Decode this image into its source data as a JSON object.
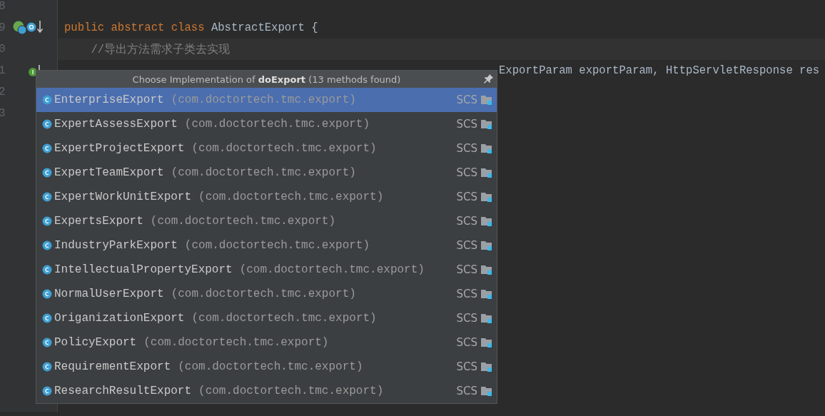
{
  "editor": {
    "lines": [
      {
        "number": "8"
      },
      {
        "number": "9",
        "kind": "class_marker",
        "code": [
          {
            "text": "public abstract class ",
            "kind": "keyword"
          },
          {
            "text": "AbstractExport {",
            "kind": "plain"
          }
        ]
      },
      {
        "number": "0",
        "current": true,
        "code": [
          {
            "text": "    //导出方法需求子类去实现",
            "kind": "comment"
          }
        ]
      },
      {
        "number": "1",
        "kind": "method_marker",
        "code": [
          {
            "text": "ExportParam exportParam, HttpServletResponse res",
            "kind": "plain"
          }
        ]
      },
      {
        "number": "2"
      },
      {
        "number": "3"
      }
    ]
  },
  "popup": {
    "title": "Choose Implementation of **doExport** (13 methods found)",
    "items": [
      {
        "name": "EnterpriseExport",
        "package": "(com.doctortech.tmc.export)",
        "module": "SCS",
        "selected": true
      },
      {
        "name": "ExpertAssessExport",
        "package": "(com.doctortech.tmc.export)",
        "module": "SCS",
        "selected": false
      },
      {
        "name": "ExpertProjectExport",
        "package": "(com.doctortech.tmc.export)",
        "module": "SCS",
        "selected": false
      },
      {
        "name": "ExpertTeamExport",
        "package": "(com.doctortech.tmc.export)",
        "module": "SCS",
        "selected": false
      },
      {
        "name": "ExpertWorkUnitExport",
        "package": "(com.doctortech.tmc.export)",
        "module": "SCS",
        "selected": false
      },
      {
        "name": "ExpertsExport",
        "package": "(com.doctortech.tmc.export)",
        "module": "SCS",
        "selected": false
      },
      {
        "name": "IndustryParkExport",
        "package": "(com.doctortech.tmc.export)",
        "module": "SCS",
        "selected": false
      },
      {
        "name": "IntellectualPropertyExport",
        "package": "(com.doctortech.tmc.export)",
        "module": "SCS",
        "selected": false
      },
      {
        "name": "NormalUserExport",
        "package": "(com.doctortech.tmc.export)",
        "module": "SCS",
        "selected": false
      },
      {
        "name": "OriganizationExport",
        "package": "(com.doctortech.tmc.export)",
        "module": "SCS",
        "selected": false
      },
      {
        "name": "PolicyExport",
        "package": "(com.doctortech.tmc.export)",
        "module": "SCS",
        "selected": false
      },
      {
        "name": "RequirementExport",
        "package": "(com.doctortech.tmc.export)",
        "module": "SCS",
        "selected": false
      },
      {
        "name": "ResearchResultExport",
        "package": "(com.doctortech.tmc.export)",
        "module": "SCS",
        "selected": false
      }
    ]
  }
}
